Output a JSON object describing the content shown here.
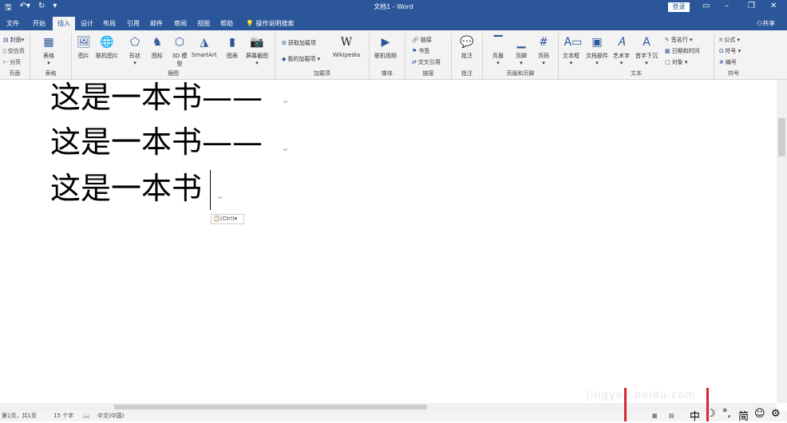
{
  "titlebar": {
    "title": "文档1 - Word",
    "login": "登录"
  },
  "tabs": [
    "文件",
    "开始",
    "插入",
    "设计",
    "布局",
    "引用",
    "邮件",
    "审阅",
    "视图",
    "帮助"
  ],
  "tell_me": "操作说明搜索",
  "share": "共享",
  "ribbon": {
    "pages": {
      "label": "页面",
      "items": [
        "封面",
        "空白页",
        "分页"
      ]
    },
    "tables": {
      "label": "表格",
      "table": "表格"
    },
    "illustrations": {
      "label": "插图",
      "items": [
        "图片",
        "联机图片",
        "形状",
        "图标",
        "3D 模型",
        "SmartArt",
        "图表",
        "屏幕截图"
      ]
    },
    "addins": {
      "label": "加载项",
      "get": "获取加载项",
      "mine": "我的加载项",
      "wiki": "Wikipedia"
    },
    "media": {
      "label": "媒体",
      "video": "联机视频"
    },
    "links": {
      "label": "链接",
      "items": [
        "链接",
        "书签",
        "交叉引用"
      ]
    },
    "comments": {
      "label": "批注",
      "comment": "批注"
    },
    "headerfooter": {
      "label": "页眉和页脚",
      "items": [
        "页眉",
        "页脚",
        "页码"
      ]
    },
    "text": {
      "label": "文本",
      "items": [
        "文本框",
        "文档部件",
        "艺术字",
        "首字下沉"
      ],
      "side": [
        "签名行",
        "日期和时间",
        "对象"
      ]
    },
    "symbols": {
      "label": "符号",
      "items": [
        "公式",
        "符号",
        "编号"
      ]
    }
  },
  "document": {
    "lines": [
      "这是一本书——",
      "这是一本书——",
      "这是一本书"
    ],
    "paste_option": "(Ctrl)"
  },
  "status": {
    "page": "第1页，共1页",
    "words": "15 个字",
    "lang": "中文(中国)"
  },
  "ime": {
    "mode": "中",
    "punct": "°,",
    "simp": "简"
  },
  "watermark": "jingyan.baidu.com",
  "colors": {
    "accent": "#2b579a",
    "annotation": "#d9242e"
  }
}
